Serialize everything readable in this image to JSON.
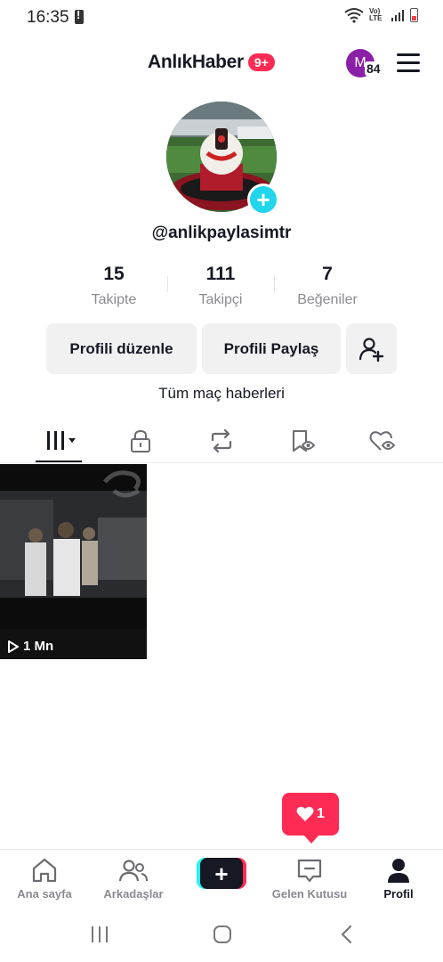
{
  "status_bar": {
    "time": "16:35",
    "network_label": "Vo) LTE"
  },
  "header": {
    "title": "AnlıkHaber",
    "badge": "9+",
    "avatar_letter": "M",
    "avatar_count": "84"
  },
  "profile": {
    "username": "@anlikpaylasimtr",
    "bio": "Tüm maç haberleri"
  },
  "stats": [
    {
      "value": "15",
      "label": "Takipte"
    },
    {
      "value": "111",
      "label": "Takipçi"
    },
    {
      "value": "7",
      "label": "Beğeniler"
    }
  ],
  "buttons": {
    "edit_profile": "Profili düzenle",
    "share_profile": "Profili Paylaş"
  },
  "tabs": [
    "videos-grid-icon",
    "lock-icon",
    "repost-icon",
    "saved-icon",
    "liked-icon"
  ],
  "videos": [
    {
      "views": "1 Mn"
    }
  ],
  "notification": {
    "count": "1"
  },
  "bottom_nav": {
    "home": "Ana sayfa",
    "friends": "Arkadaşlar",
    "inbox": "Gelen Kutusu",
    "profile": "Profil"
  },
  "colors": {
    "accent": "#fe2c55",
    "cyan": "#25f4ee",
    "add_button": "#20d5ec",
    "avatar_purple": "#8a1fa8"
  }
}
